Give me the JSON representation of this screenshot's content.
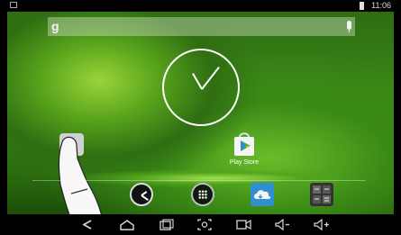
{
  "status_bar": {
    "time": "11:06",
    "notification_icon": "notification-icon",
    "battery_icon": "battery-icon"
  },
  "search": {
    "brand": "g",
    "voice_icon": "mic-icon"
  },
  "home_apps": [
    {
      "label": "Play Store",
      "icon": "play-store-icon"
    }
  ],
  "dock_apps": [
    "clock-icon",
    "apps-icon",
    "cloud-icon",
    "calculator-icon"
  ],
  "navigation": [
    "back-icon",
    "home-icon",
    "recent-apps-icon",
    "screenshot-icon",
    "camera-icon",
    "volume-down-icon",
    "volume-up-icon"
  ],
  "colors": {
    "wallpaper": "#3c8a18",
    "system_bars": "#000000",
    "text": "#ffffff"
  }
}
